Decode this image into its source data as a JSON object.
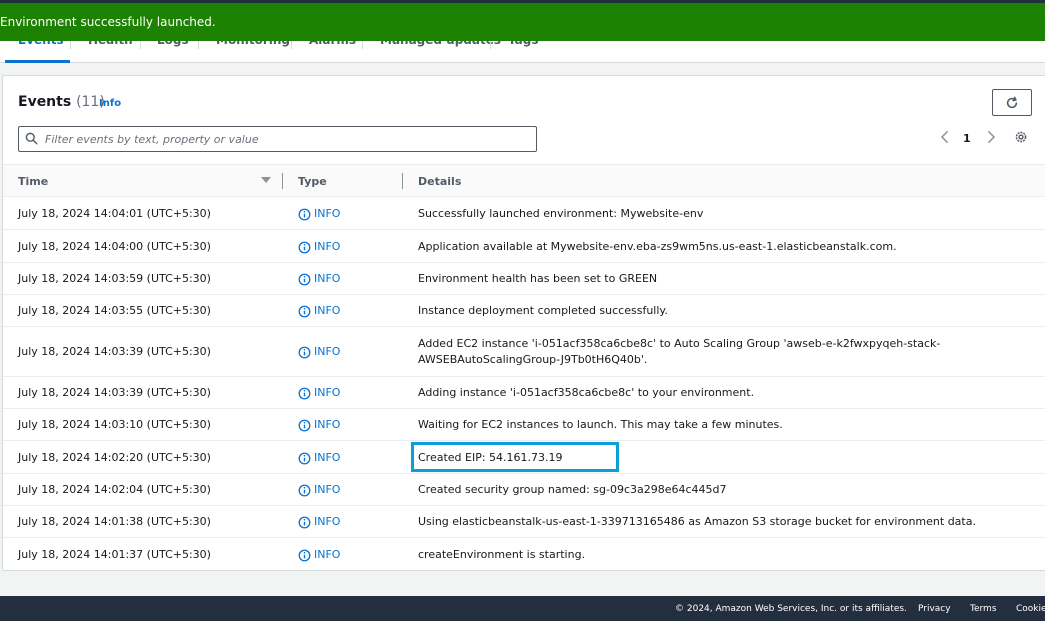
{
  "flash": {
    "message": "Environment successfully launched."
  },
  "tabs": [
    {
      "label": "Events"
    },
    {
      "label": "Health"
    },
    {
      "label": "Logs"
    },
    {
      "label": "Monitoring"
    },
    {
      "label": "Alarms"
    },
    {
      "label": "Managed updates"
    },
    {
      "label": "Tags"
    }
  ],
  "events": {
    "title": "Events",
    "count": "(11)",
    "info_link": "Info",
    "search_placeholder": "Filter events by text, property or value",
    "page": "1",
    "columns": {
      "time": "Time",
      "type": "Type",
      "details": "Details"
    },
    "rows": [
      {
        "time": "July 18, 2024 14:04:01 (UTC+5:30)",
        "type": "INFO",
        "details": "Successfully launched environment: Mywebsite-env"
      },
      {
        "time": "July 18, 2024 14:04:00 (UTC+5:30)",
        "type": "INFO",
        "details": "Application available at Mywebsite-env.eba-zs9wm5ns.us-east-1.elasticbeanstalk.com."
      },
      {
        "time": "July 18, 2024 14:03:59 (UTC+5:30)",
        "type": "INFO",
        "details": "Environment health has been set to GREEN"
      },
      {
        "time": "July 18, 2024 14:03:55 (UTC+5:30)",
        "type": "INFO",
        "details": "Instance deployment completed successfully."
      },
      {
        "time": "July 18, 2024 14:03:39 (UTC+5:30)",
        "type": "INFO",
        "details": "Added EC2 instance 'i-051acf358ca6cbe8c' to Auto Scaling Group 'awseb-e-k2fwxpyqeh-stack-AWSEBAutoScalingGroup-J9Tb0tH6Q40b'."
      },
      {
        "time": "July 18, 2024 14:03:39 (UTC+5:30)",
        "type": "INFO",
        "details": "Adding instance 'i-051acf358ca6cbe8c' to your environment."
      },
      {
        "time": "July 18, 2024 14:03:10 (UTC+5:30)",
        "type": "INFO",
        "details": "Waiting for EC2 instances to launch. This may take a few minutes."
      },
      {
        "time": "July 18, 2024 14:02:20 (UTC+5:30)",
        "type": "INFO",
        "details": "Created EIP: 54.161.73.19"
      },
      {
        "time": "July 18, 2024 14:02:04 (UTC+5:30)",
        "type": "INFO",
        "details": "Created security group named: sg-09c3a298e64c445d7"
      },
      {
        "time": "July 18, 2024 14:01:38 (UTC+5:30)",
        "type": "INFO",
        "details": "Using elasticbeanstalk-us-east-1-339713165486 as Amazon S3 storage bucket for environment data."
      },
      {
        "time": "July 18, 2024 14:01:37 (UTC+5:30)",
        "type": "INFO",
        "details": "createEnvironment is starting."
      }
    ]
  },
  "footer": {
    "copyright": "© 2024, Amazon Web Services, Inc. or its affiliates.",
    "privacy": "Privacy",
    "terms": "Terms",
    "cookies": "Cookie"
  },
  "colors": {
    "success": "#1d8102",
    "link": "#0972d3",
    "highlight": "#0a9edb",
    "footer": "#232f3e"
  }
}
